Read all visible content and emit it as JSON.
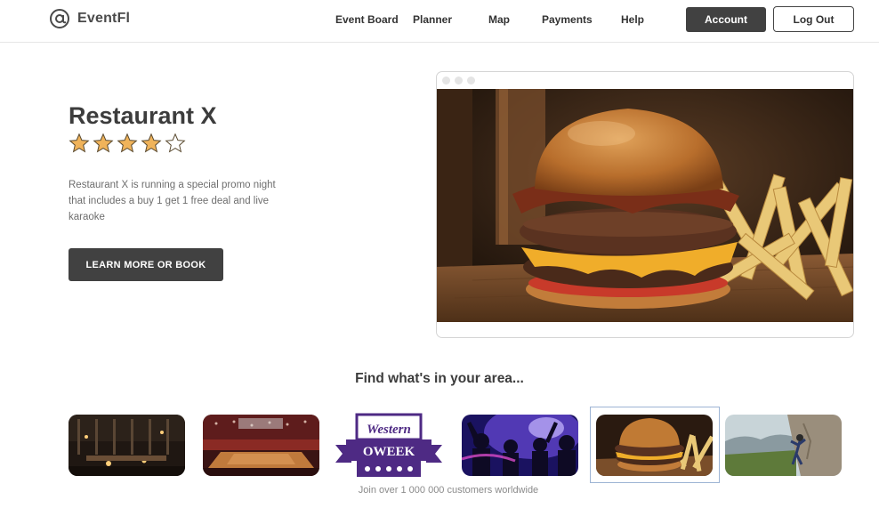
{
  "header": {
    "logo_text": "EventFl",
    "logo_icon": "at-sign-icon",
    "nav": [
      "Event Board",
      "Planner",
      "Map",
      "Payments",
      "Help"
    ],
    "account_label": "Account",
    "logout_label": "Log Out"
  },
  "hero": {
    "title": "Restaurant X",
    "rating": 4,
    "rating_max": 5,
    "description": "Restaurant X is running a special promo night that includes a buy 1 get 1 free deal and live karaoke",
    "cta_label": "LEARN MORE OR BOOK",
    "image": "burger-and-fries-photo"
  },
  "area": {
    "title": "Find what's in your area...",
    "thumbnails": [
      "restaurant-interior",
      "basketball-arena",
      "western-oweek-badge",
      "nightclub-party",
      "burger-and-fries",
      "rock-climbing"
    ],
    "badge_line1": "Western",
    "badge_line2": "OWEEK",
    "footer": "Join over 1 000 000 customers worldwide"
  },
  "colors": {
    "dark_button": "#414141",
    "star_fill": "#f0b35a",
    "badge_purple": "#4e2a84"
  }
}
